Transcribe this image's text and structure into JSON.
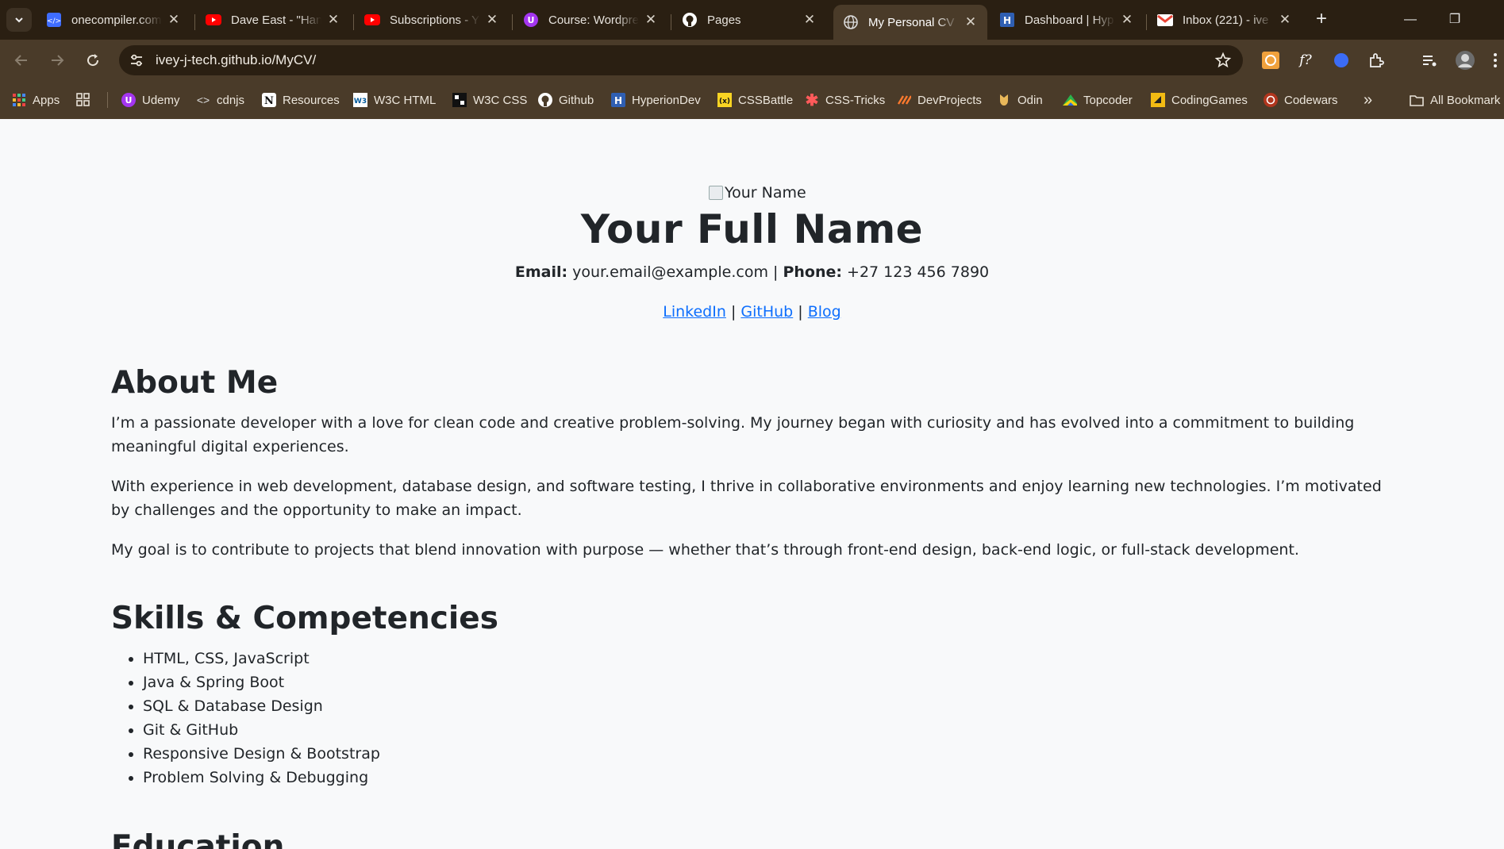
{
  "browser": {
    "tabs": [
      {
        "title": "onecompiler.com",
        "icon": "code-icon",
        "color": "#3f6dff"
      },
      {
        "title": "Dave East - \"Han",
        "icon": "youtube-icon",
        "color": "#ff0000"
      },
      {
        "title": "Subscriptions - Y",
        "icon": "youtube-icon",
        "color": "#ff0000"
      },
      {
        "title": "Course: Wordpre",
        "icon": "udemy-icon",
        "color": "#a435f0"
      },
      {
        "title": "Pages",
        "icon": "github-icon",
        "color": "#ffffff"
      },
      {
        "title": "My Personal CV",
        "icon": "globe-icon",
        "color": "#cfcfcf",
        "active": true
      },
      {
        "title": "Dashboard | Hyp",
        "icon": "hyperiondev-icon",
        "color": "#4a7fd4"
      },
      {
        "title": "Inbox (221) - ive",
        "icon": "gmail-icon",
        "color": "#ea4335"
      }
    ],
    "url": "ivey-j-tech.github.io/MyCV/",
    "bookmarks": [
      {
        "label": "Apps",
        "icon": "apps-grid-icon"
      },
      {
        "label": "",
        "icon": "tab-groups-icon"
      },
      {
        "label": "Udemy",
        "icon": "udemy-icon"
      },
      {
        "label": "cdnjs",
        "icon": "cdnjs-icon"
      },
      {
        "label": "Resources",
        "icon": "notion-icon"
      },
      {
        "label": "W3C HTML",
        "icon": "w3c-icon"
      },
      {
        "label": "W3C CSS",
        "icon": "w3c-css-icon"
      },
      {
        "label": "Github",
        "icon": "github-icon"
      },
      {
        "label": "HyperionDev",
        "icon": "hyperiondev-icon"
      },
      {
        "label": "CSSBattle",
        "icon": "cssbattle-icon"
      },
      {
        "label": "CSS-Tricks",
        "icon": "css-tricks-icon"
      },
      {
        "label": "DevProjects",
        "icon": "devprojects-icon"
      },
      {
        "label": "Odin",
        "icon": "odin-icon"
      },
      {
        "label": "Topcoder",
        "icon": "topcoder-icon"
      },
      {
        "label": "CodingGames",
        "icon": "codingame-icon"
      },
      {
        "label": "Codewars",
        "icon": "codewars-icon"
      }
    ],
    "overflow_label": "»",
    "all_bookmarks_label": "All Bookmark"
  },
  "cv": {
    "avatar_alt": "Your Name",
    "name": "Your Full Name",
    "email_label": "Email:",
    "email": "your.email@example.com",
    "separator": "|",
    "phone_label": "Phone:",
    "phone": "+27 123 456 7890",
    "links": [
      "LinkedIn",
      "GitHub",
      "Blog"
    ],
    "about": {
      "heading": "About Me",
      "paragraphs": [
        "I’m a passionate developer with a love for clean code and creative problem-solving. My journey began with curiosity and has evolved into a commitment to building meaningful digital experiences.",
        "With experience in web development, database design, and software testing, I thrive in collaborative environments and enjoy learning new technologies. I’m motivated by challenges and the opportunity to make an impact.",
        "My goal is to contribute to projects that blend innovation with purpose — whether that’s through front-end design, back-end logic, or full-stack development."
      ]
    },
    "skills": {
      "heading": "Skills & Competencies",
      "items": [
        "HTML, CSS, JavaScript",
        "Java & Spring Boot",
        "SQL & Database Design",
        "Git & GitHub",
        "Responsive Design & Bootstrap",
        "Problem Solving & Debugging"
      ]
    },
    "education": {
      "heading": "Education"
    }
  },
  "colors": {
    "chrome_dark": "#2a1f12",
    "chrome_toolbar": "#4a3b29",
    "page_bg": "#f8f9fa",
    "link": "#0d6efd"
  }
}
